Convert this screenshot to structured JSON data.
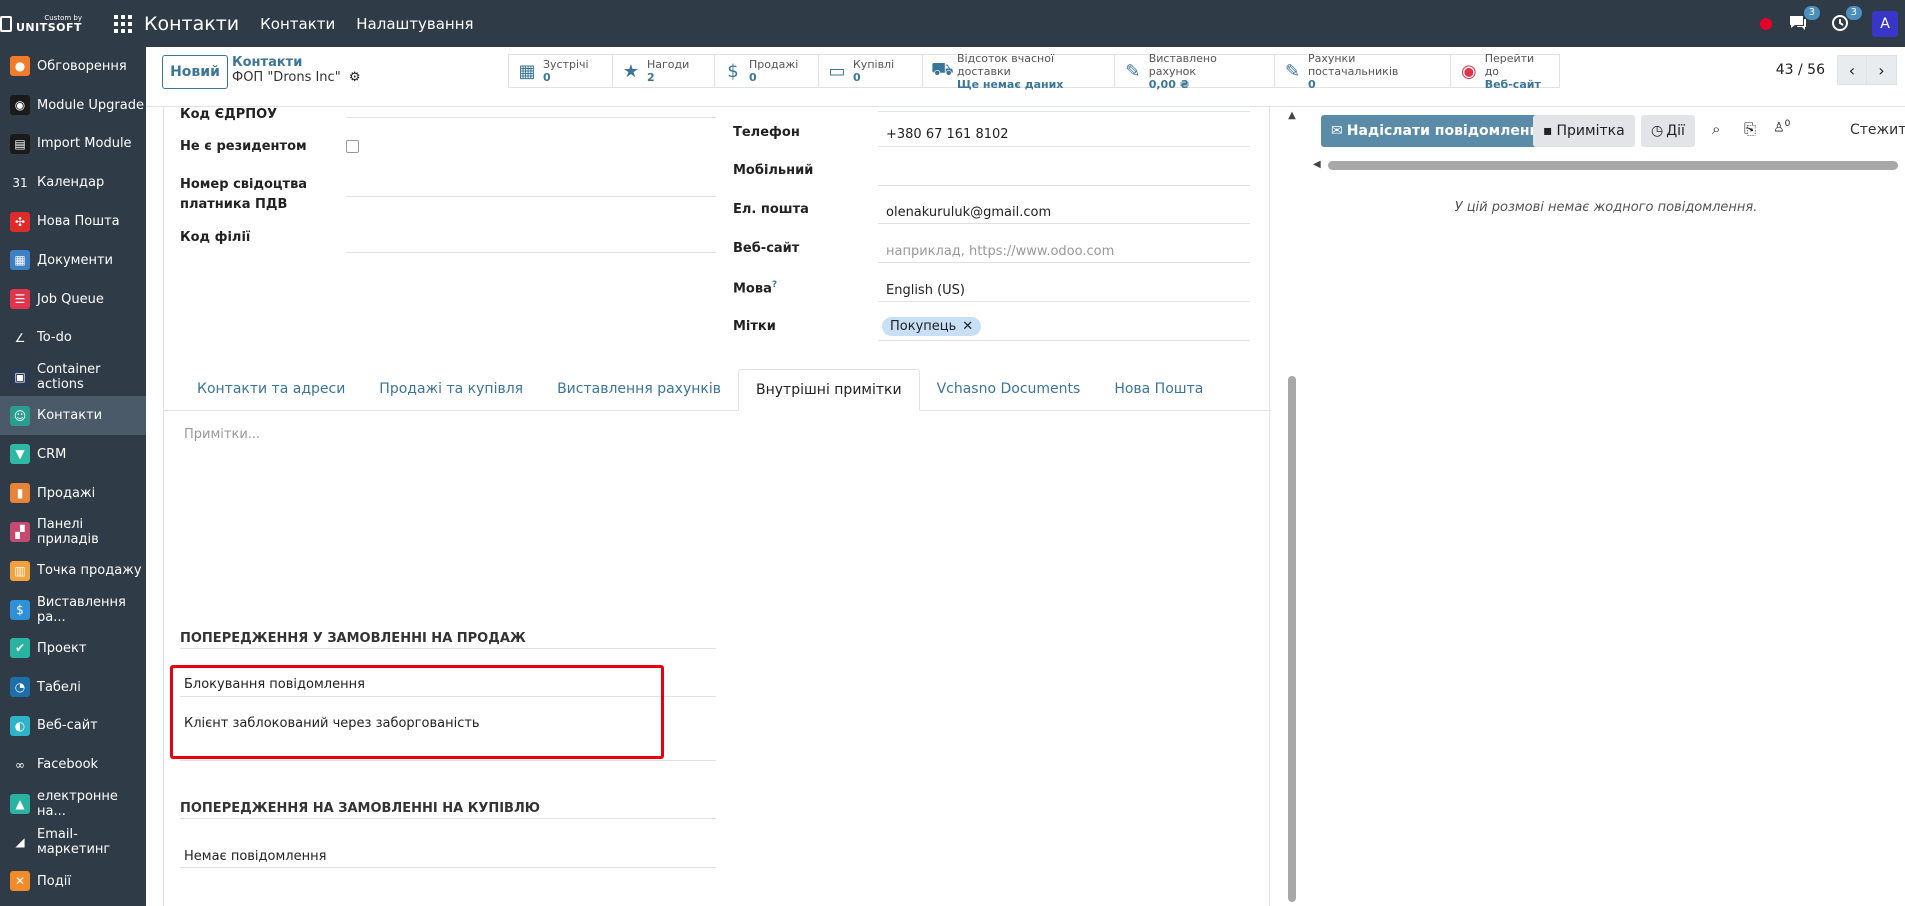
{
  "topbar": {
    "brand_small": "Custom by",
    "brand_big": "UNITSOFT",
    "app_title": "Контакти",
    "menu": [
      "Контакти",
      "Налаштування"
    ],
    "messages_badge": "3",
    "activities_badge": "3",
    "avatar_letter": "A"
  },
  "sidebar": {
    "items": [
      {
        "label": "Обговорення",
        "icon": "discuss-icon",
        "color": "#f27b2a",
        "glyph": "●"
      },
      {
        "label": "Module Upgrade",
        "icon": "upgrade-icon",
        "color": "#1a1a1a",
        "glyph": "◉"
      },
      {
        "label": "Import Module",
        "icon": "import-icon",
        "color": "#1a1a1a",
        "glyph": "▤"
      },
      {
        "label": "Календар",
        "icon": "calendar-icon",
        "color": "#2f3b46",
        "glyph": "31"
      },
      {
        "label": "Нова Пошта",
        "icon": "nova-poshta-icon",
        "color": "#e02b2b",
        "glyph": "✣"
      },
      {
        "label": "Документи",
        "icon": "documents-icon",
        "color": "#3f7fc4",
        "glyph": "▦"
      },
      {
        "label": "Job Queue",
        "icon": "job-queue-icon",
        "color": "#e0344c",
        "glyph": "☰"
      },
      {
        "label": "To-do",
        "icon": "todo-icon",
        "color": "#2f3b46",
        "glyph": "∠"
      },
      {
        "label": "Container actions",
        "icon": "container-icon",
        "color": "#2b3a52",
        "glyph": "▣"
      },
      {
        "label": "Контакти",
        "icon": "contacts-icon",
        "color": "#2a9d8f",
        "glyph": "☺"
      },
      {
        "label": "CRM",
        "icon": "crm-icon",
        "color": "#2fb8a3",
        "glyph": "▼"
      },
      {
        "label": "Продажі",
        "icon": "sales-icon",
        "color": "#e8843a",
        "glyph": "▮"
      },
      {
        "label": "Панелі приладів",
        "icon": "dashboard-icon",
        "color": "#c74a6e",
        "glyph": "▞"
      },
      {
        "label": "Точка продажу",
        "icon": "pos-icon",
        "color": "#f2a23a",
        "glyph": "▥"
      },
      {
        "label": "Виставлення ра...",
        "icon": "invoicing-icon",
        "color": "#2f8fd8",
        "glyph": "$"
      },
      {
        "label": "Проект",
        "icon": "project-icon",
        "color": "#2ab3a0",
        "glyph": "✔"
      },
      {
        "label": "Табелі",
        "icon": "timesheet-icon",
        "color": "#1c6fa8",
        "glyph": "◔"
      },
      {
        "label": "Веб-сайт",
        "icon": "website-icon",
        "color": "#2fb3c8",
        "glyph": "◐"
      },
      {
        "label": "Facebook",
        "icon": "facebook-icon",
        "color": "#2f3b46",
        "glyph": "∞"
      },
      {
        "label": "електронне на...",
        "icon": "elearning-icon",
        "color": "#2ab3a0",
        "glyph": "▲"
      },
      {
        "label": "Email-маркетинг",
        "icon": "email-marketing-icon",
        "color": "#2f3b46",
        "glyph": "◢"
      },
      {
        "label": "Події",
        "icon": "events-icon",
        "color": "#f28c2a",
        "glyph": "✕"
      }
    ]
  },
  "control": {
    "new_label": "Новий",
    "crumb_parent": "Контакти",
    "crumb_current": "ФОП \"Drons Inc\"",
    "smart_buttons": [
      {
        "icon": "calendar-icon",
        "glyph": "▦",
        "label": "Зустрічі",
        "value": "0"
      },
      {
        "icon": "star-icon",
        "glyph": "★",
        "label": "Нагоди",
        "value": "2"
      },
      {
        "icon": "dollar-icon",
        "glyph": "$",
        "label": "Продажі",
        "value": "0"
      },
      {
        "icon": "credit-card-icon",
        "glyph": "▭",
        "label": "Купівлі",
        "value": "0"
      },
      {
        "icon": "truck-icon",
        "glyph": "⛟",
        "label": "Відсоток вчасної доставки",
        "value": "Ще немає даних"
      },
      {
        "icon": "pencil-square-icon",
        "glyph": "✎",
        "label": "Виставлено рахунок",
        "value": "0,00 ₴"
      },
      {
        "icon": "pencil-square-icon",
        "glyph": "✎",
        "label": "Рахунки постачальників",
        "value": "0"
      },
      {
        "icon": "globe-icon",
        "glyph": "◉",
        "label": "Перейти до",
        "value": "Веб-сайт"
      }
    ],
    "pager": "43 / 56"
  },
  "form": {
    "left": {
      "edrpou_label": "Код ЄДРПОУ",
      "nonresident_label": "Не є резидентом",
      "vat_cert_label_1": "Номер свідоцтва",
      "vat_cert_label_2": "платника ПДВ",
      "branch_code_label": "Код філії"
    },
    "right": {
      "phone_label": "Телефон",
      "phone_value": "+380 67 161 8102",
      "mobile_label": "Мобільний",
      "email_label": "Ел. пошта",
      "email_value": "olenakuruluk@gmail.com",
      "website_label": "Веб-сайт",
      "website_placeholder": "наприклад, https://www.odoo.com",
      "language_label": "Мова",
      "language_help": "?",
      "language_value": "English (US)",
      "tags_label": "Мітки",
      "tag_value": "Покупець"
    },
    "tabs": [
      "Контакти та адреси",
      "Продажі та купівля",
      "Виставлення рахунків",
      "Внутрішні примітки",
      "Vchasno Documents",
      "Нова Пошта"
    ],
    "notes_placeholder": "Примітки...",
    "sale_warning_title": "Попередження у замовленні на продаж",
    "sale_warning_type": "Блокування повідомлення",
    "sale_warning_message": "Клієнт заблокований через заборгованість",
    "purchase_warning_title": "Попередження на замовленні на купівлю",
    "purchase_warning_type": "Немає повідомлення"
  },
  "chatter": {
    "send_label": "Надіслати повідомлення",
    "note_label": "Примітка",
    "activities_label": "Дії",
    "followers_count": "0",
    "follow_label": "Стежити",
    "empty_message": "У цій розмові немає жодного повідомлення."
  }
}
